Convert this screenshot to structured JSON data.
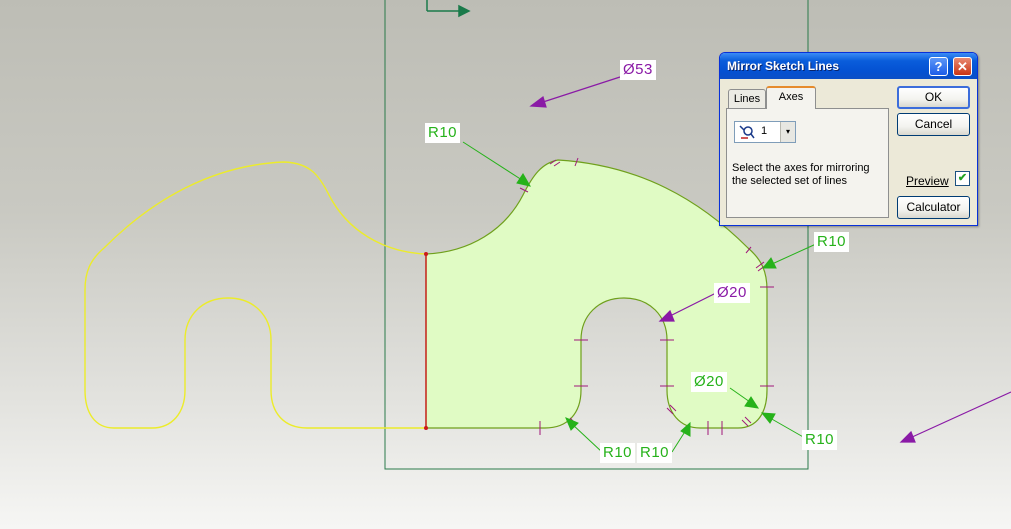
{
  "dimensions": {
    "dia53": "Ø53",
    "r10_top_left": "R10",
    "r10_right": "R10",
    "dia20_slot": "Ø20",
    "dia20_lower": "Ø20",
    "r10_bottom_a": "R10",
    "r10_bottom_b": "R10",
    "r10_bottom_right": "R10"
  },
  "colors": {
    "sketch_fill": "#e0fbc4",
    "profile_line": "#6fa01c",
    "mirror_line": "#ecec2a",
    "axis_line": "#cc1a1a",
    "dimension_green": "#26b21a",
    "dimension_purple": "#8a1aa6",
    "frame_line": "#2a7a4a"
  },
  "dialog": {
    "title": "Mirror Sketch Lines",
    "help_glyph": "?",
    "close_glyph": "✕",
    "tabs": [
      "Lines",
      "Axes"
    ],
    "active_tab": "Axes",
    "axis_value": "1",
    "axis_icon": "mirror-axis-icon",
    "dropdown_arrow": "▾",
    "instructions": "Select the axes for mirroring the selected set of lines",
    "buttons": {
      "ok": "OK",
      "cancel": "Cancel",
      "preview": "Preview",
      "calculator": "Calculator"
    },
    "preview_checked": true,
    "check_glyph": "✔"
  }
}
